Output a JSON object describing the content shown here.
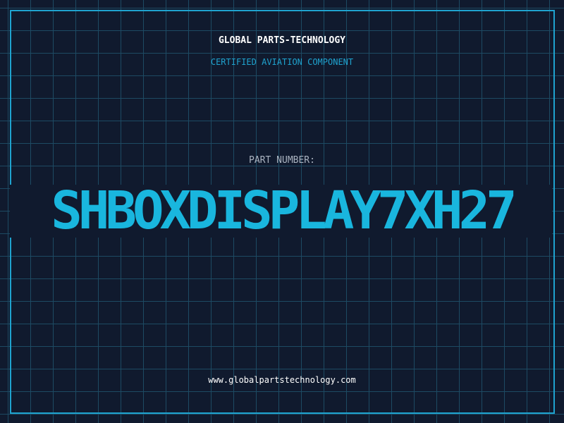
{
  "header": {
    "brand": "GLOBAL PARTS-TECHNOLOGY",
    "subtitle": "CERTIFIED AVIATION COMPONENT"
  },
  "part": {
    "label": "PART NUMBER:",
    "number": "SHBOXDISPLAY7XH27"
  },
  "footer": {
    "website": "www.globalpartstechnology.com"
  },
  "colors": {
    "background": "#101a2e",
    "grid": "#1d4a63",
    "accent": "#1fa3cf",
    "part_number": "#19b6de",
    "label": "#aab3c0",
    "text": "#ffffff"
  }
}
